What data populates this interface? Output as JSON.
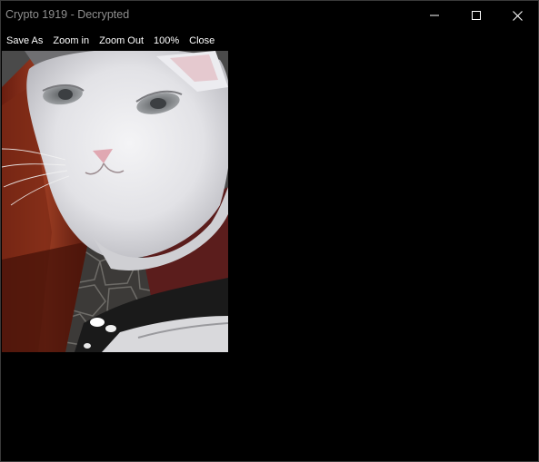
{
  "window": {
    "title": "Crypto 1919 - Decrypted"
  },
  "menu": {
    "items": [
      {
        "id": "save-as",
        "label": "Save As"
      },
      {
        "id": "zoom-in",
        "label": "Zoom in"
      },
      {
        "id": "zoom-out",
        "label": "Zoom Out"
      },
      {
        "id": "zoom-100",
        "label": "100%"
      },
      {
        "id": "close",
        "label": "Close"
      }
    ]
  },
  "controls": {
    "minimize_icon": "minimize-icon",
    "maximize_icon": "maximize-icon",
    "close_icon": "close-icon"
  },
  "image": {
    "content": "decrypted photo of a white cat"
  },
  "colors": {
    "window_bg": "#000000",
    "title_text": "#8f8f8f",
    "menu_text": "#ffffff"
  }
}
